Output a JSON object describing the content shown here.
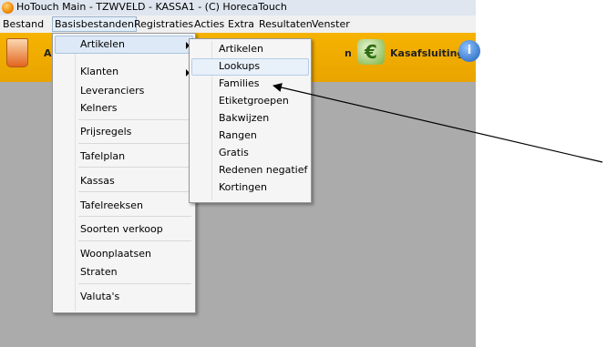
{
  "window": {
    "title": "HoTouch Main - TZWVELD - KASSA1 - (C) HorecaTouch"
  },
  "menubar": [
    "Bestand",
    "Basisbestanden",
    "Registraties",
    "Acties",
    "Extra",
    "Resultaten",
    "Venster"
  ],
  "toolbar": {
    "left_partial_label": "A",
    "mid_partial_label": "n",
    "kasafsluiting": "Kasafsluiting"
  },
  "basis_menu": {
    "items": [
      "Artikelen",
      "Klanten",
      "Leveranciers",
      "Kelners",
      "Prijsregels",
      "Tafelplan",
      "Kassas",
      "Tafelreeksen",
      "Soorten verkoop",
      "Woonplaatsen",
      "Straten",
      "Valuta's"
    ]
  },
  "artikelen_submenu": {
    "items": [
      "Artikelen",
      "Lookups",
      "Families",
      "Etiketgroepen",
      "Bakwijzen",
      "Rangen",
      "Gratis",
      "Redenen negatief",
      "Kortingen"
    ]
  },
  "colors": {
    "toolbar": "#f0ad00",
    "workspace": "#ababab",
    "menu_bg": "#f5f5f5",
    "highlight": "#dde9f6"
  },
  "icons": [
    "app-logo-icon",
    "drink-cup-icon",
    "euro-icon",
    "info-icon",
    "submenu-arrow-icon"
  ]
}
